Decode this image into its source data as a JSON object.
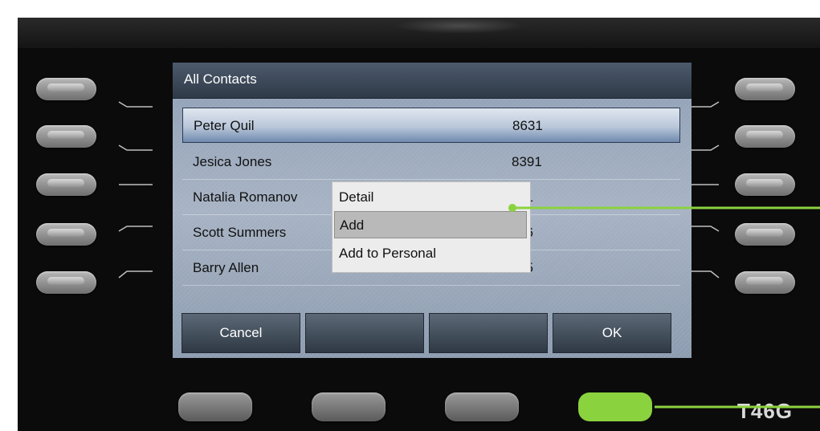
{
  "screen": {
    "title": "All Contacts",
    "contacts": [
      {
        "name": "Peter Quil",
        "number": "8631"
      },
      {
        "name": "Jesica Jones",
        "number": "8391"
      },
      {
        "name": "Natalia Romanov",
        "number": "91"
      },
      {
        "name": "Scott Summers",
        "number": "56"
      },
      {
        "name": "Barry Allen",
        "number": "55"
      }
    ],
    "selected_index": 0,
    "context_menu": {
      "items": [
        "Detail",
        "Add",
        "Add to Personal"
      ],
      "highlighted_index": 1
    },
    "softkeys": [
      "Cancel",
      "",
      "",
      "OK"
    ]
  },
  "phone": {
    "model": "T46G"
  },
  "colors": {
    "callout_green": "#8bd23f",
    "title_bar": "#3a4656",
    "screen_bg": "#9eacbf"
  }
}
